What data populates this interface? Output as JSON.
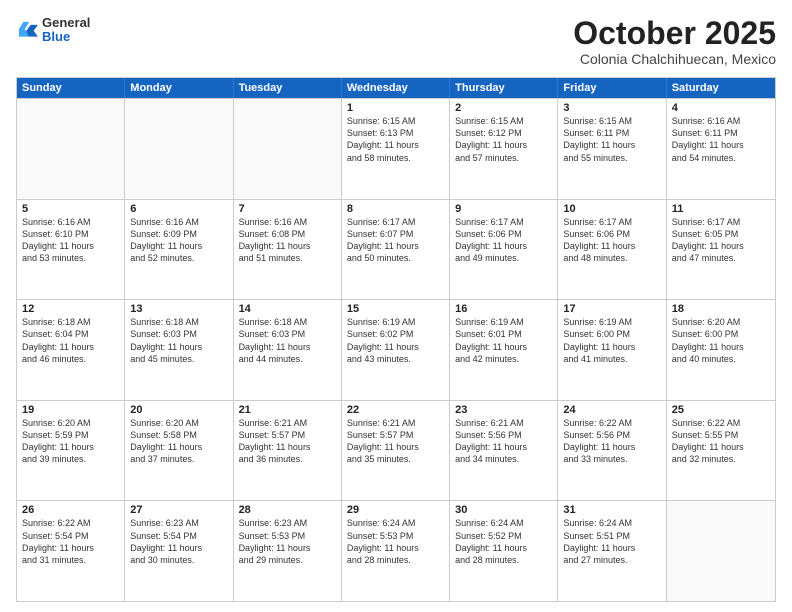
{
  "logo": {
    "general": "General",
    "blue": "Blue"
  },
  "header": {
    "month": "October 2025",
    "location": "Colonia Chalchihuecan, Mexico"
  },
  "days": [
    "Sunday",
    "Monday",
    "Tuesday",
    "Wednesday",
    "Thursday",
    "Friday",
    "Saturday"
  ],
  "rows": [
    [
      {
        "day": "",
        "lines": []
      },
      {
        "day": "",
        "lines": []
      },
      {
        "day": "",
        "lines": []
      },
      {
        "day": "1",
        "lines": [
          "Sunrise: 6:15 AM",
          "Sunset: 6:13 PM",
          "Daylight: 11 hours",
          "and 58 minutes."
        ]
      },
      {
        "day": "2",
        "lines": [
          "Sunrise: 6:15 AM",
          "Sunset: 6:12 PM",
          "Daylight: 11 hours",
          "and 57 minutes."
        ]
      },
      {
        "day": "3",
        "lines": [
          "Sunrise: 6:15 AM",
          "Sunset: 6:11 PM",
          "Daylight: 11 hours",
          "and 55 minutes."
        ]
      },
      {
        "day": "4",
        "lines": [
          "Sunrise: 6:16 AM",
          "Sunset: 6:11 PM",
          "Daylight: 11 hours",
          "and 54 minutes."
        ]
      }
    ],
    [
      {
        "day": "5",
        "lines": [
          "Sunrise: 6:16 AM",
          "Sunset: 6:10 PM",
          "Daylight: 11 hours",
          "and 53 minutes."
        ]
      },
      {
        "day": "6",
        "lines": [
          "Sunrise: 6:16 AM",
          "Sunset: 6:09 PM",
          "Daylight: 11 hours",
          "and 52 minutes."
        ]
      },
      {
        "day": "7",
        "lines": [
          "Sunrise: 6:16 AM",
          "Sunset: 6:08 PM",
          "Daylight: 11 hours",
          "and 51 minutes."
        ]
      },
      {
        "day": "8",
        "lines": [
          "Sunrise: 6:17 AM",
          "Sunset: 6:07 PM",
          "Daylight: 11 hours",
          "and 50 minutes."
        ]
      },
      {
        "day": "9",
        "lines": [
          "Sunrise: 6:17 AM",
          "Sunset: 6:06 PM",
          "Daylight: 11 hours",
          "and 49 minutes."
        ]
      },
      {
        "day": "10",
        "lines": [
          "Sunrise: 6:17 AM",
          "Sunset: 6:06 PM",
          "Daylight: 11 hours",
          "and 48 minutes."
        ]
      },
      {
        "day": "11",
        "lines": [
          "Sunrise: 6:17 AM",
          "Sunset: 6:05 PM",
          "Daylight: 11 hours",
          "and 47 minutes."
        ]
      }
    ],
    [
      {
        "day": "12",
        "lines": [
          "Sunrise: 6:18 AM",
          "Sunset: 6:04 PM",
          "Daylight: 11 hours",
          "and 46 minutes."
        ]
      },
      {
        "day": "13",
        "lines": [
          "Sunrise: 6:18 AM",
          "Sunset: 6:03 PM",
          "Daylight: 11 hours",
          "and 45 minutes."
        ]
      },
      {
        "day": "14",
        "lines": [
          "Sunrise: 6:18 AM",
          "Sunset: 6:03 PM",
          "Daylight: 11 hours",
          "and 44 minutes."
        ]
      },
      {
        "day": "15",
        "lines": [
          "Sunrise: 6:19 AM",
          "Sunset: 6:02 PM",
          "Daylight: 11 hours",
          "and 43 minutes."
        ]
      },
      {
        "day": "16",
        "lines": [
          "Sunrise: 6:19 AM",
          "Sunset: 6:01 PM",
          "Daylight: 11 hours",
          "and 42 minutes."
        ]
      },
      {
        "day": "17",
        "lines": [
          "Sunrise: 6:19 AM",
          "Sunset: 6:00 PM",
          "Daylight: 11 hours",
          "and 41 minutes."
        ]
      },
      {
        "day": "18",
        "lines": [
          "Sunrise: 6:20 AM",
          "Sunset: 6:00 PM",
          "Daylight: 11 hours",
          "and 40 minutes."
        ]
      }
    ],
    [
      {
        "day": "19",
        "lines": [
          "Sunrise: 6:20 AM",
          "Sunset: 5:59 PM",
          "Daylight: 11 hours",
          "and 39 minutes."
        ]
      },
      {
        "day": "20",
        "lines": [
          "Sunrise: 6:20 AM",
          "Sunset: 5:58 PM",
          "Daylight: 11 hours",
          "and 37 minutes."
        ]
      },
      {
        "day": "21",
        "lines": [
          "Sunrise: 6:21 AM",
          "Sunset: 5:57 PM",
          "Daylight: 11 hours",
          "and 36 minutes."
        ]
      },
      {
        "day": "22",
        "lines": [
          "Sunrise: 6:21 AM",
          "Sunset: 5:57 PM",
          "Daylight: 11 hours",
          "and 35 minutes."
        ]
      },
      {
        "day": "23",
        "lines": [
          "Sunrise: 6:21 AM",
          "Sunset: 5:56 PM",
          "Daylight: 11 hours",
          "and 34 minutes."
        ]
      },
      {
        "day": "24",
        "lines": [
          "Sunrise: 6:22 AM",
          "Sunset: 5:56 PM",
          "Daylight: 11 hours",
          "and 33 minutes."
        ]
      },
      {
        "day": "25",
        "lines": [
          "Sunrise: 6:22 AM",
          "Sunset: 5:55 PM",
          "Daylight: 11 hours",
          "and 32 minutes."
        ]
      }
    ],
    [
      {
        "day": "26",
        "lines": [
          "Sunrise: 6:22 AM",
          "Sunset: 5:54 PM",
          "Daylight: 11 hours",
          "and 31 minutes."
        ]
      },
      {
        "day": "27",
        "lines": [
          "Sunrise: 6:23 AM",
          "Sunset: 5:54 PM",
          "Daylight: 11 hours",
          "and 30 minutes."
        ]
      },
      {
        "day": "28",
        "lines": [
          "Sunrise: 6:23 AM",
          "Sunset: 5:53 PM",
          "Daylight: 11 hours",
          "and 29 minutes."
        ]
      },
      {
        "day": "29",
        "lines": [
          "Sunrise: 6:24 AM",
          "Sunset: 5:53 PM",
          "Daylight: 11 hours",
          "and 28 minutes."
        ]
      },
      {
        "day": "30",
        "lines": [
          "Sunrise: 6:24 AM",
          "Sunset: 5:52 PM",
          "Daylight: 11 hours",
          "and 28 minutes."
        ]
      },
      {
        "day": "31",
        "lines": [
          "Sunrise: 6:24 AM",
          "Sunset: 5:51 PM",
          "Daylight: 11 hours",
          "and 27 minutes."
        ]
      },
      {
        "day": "",
        "lines": []
      }
    ]
  ]
}
